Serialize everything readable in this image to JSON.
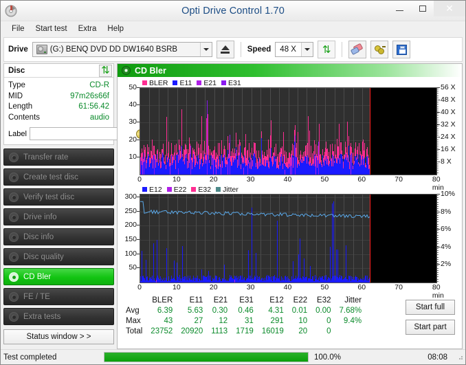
{
  "window": {
    "title": "Opti Drive Control 1.70",
    "icon": "disc-app-icon",
    "minimize": "–",
    "maximize": "□",
    "close": "✕"
  },
  "menubar": {
    "items": [
      {
        "label": "File"
      },
      {
        "label": "Start test"
      },
      {
        "label": "Extra"
      },
      {
        "label": "Help"
      }
    ]
  },
  "toolbar": {
    "drive_label": "Drive",
    "drive_letter": "(G:)",
    "drive_name": "BENQ DVD DD DW1640 BSRB",
    "drive_value": "(G:)   BENQ DVD DD DW1640 BSRB",
    "eject_icon": "eject-icon",
    "speed_label": "Speed",
    "speed_value": "48 X",
    "refresh_icon": "refresh-icon",
    "eraser_icon": "eraser-icon",
    "plug_icon": "plug-icon",
    "save_icon": "save-icon"
  },
  "disc": {
    "header": "Disc",
    "refresh_icon": "refresh-icon",
    "rows": [
      {
        "key": "Type",
        "value": "CD-R"
      },
      {
        "key": "MID",
        "value": "97m26s66f"
      },
      {
        "key": "Length",
        "value": "61:56.42"
      },
      {
        "key": "Contents",
        "value": "audio"
      }
    ],
    "label_key": "Label",
    "label_value": "",
    "label_placeholder": "",
    "disc_button_icon": "cd-icon"
  },
  "sidebar": {
    "items": [
      {
        "label": "Transfer rate",
        "icon": "disc-icon",
        "active": false
      },
      {
        "label": "Create test disc",
        "icon": "disc-write-icon",
        "active": false
      },
      {
        "label": "Verify test disc",
        "icon": "disc-check-icon",
        "active": false
      },
      {
        "label": "Drive info",
        "icon": "drive-info-icon",
        "active": false
      },
      {
        "label": "Disc info",
        "icon": "disc-info-icon",
        "active": false
      },
      {
        "label": "Disc quality",
        "icon": "disc-quality-icon",
        "active": false
      },
      {
        "label": "CD Bler",
        "icon": "cd-bler-icon",
        "active": true
      },
      {
        "label": "FE / TE",
        "icon": "fe-te-icon",
        "active": false
      },
      {
        "label": "Extra tests",
        "icon": "extra-tests-icon",
        "active": false
      }
    ],
    "status_window": "Status window > >"
  },
  "panel": {
    "title": "CD Bler",
    "icon": "cd-bler-icon",
    "start_full": "Start full",
    "start_part": "Start part"
  },
  "statusbar": {
    "text": "Test completed",
    "percent": "100.0%",
    "progress": 100,
    "time": "08:08",
    "accent": "#0aa00a"
  },
  "chart_data": [
    {
      "type": "bar",
      "name": "cd-bler-error-chart",
      "title": "",
      "xlabel": "min",
      "ylabel": "",
      "xlim": [
        0,
        80
      ],
      "ylim": [
        0,
        50
      ],
      "yticks": [
        10,
        20,
        30,
        40,
        50
      ],
      "xticks": [
        0,
        10,
        20,
        30,
        40,
        50,
        60,
        70,
        80
      ],
      "xtick_labels": [
        "0",
        "10",
        "20",
        "30",
        "40",
        "50",
        "60",
        "70",
        "80 min"
      ],
      "right_axis": {
        "label": "X",
        "ticks": [
          8,
          16,
          24,
          32,
          40,
          48,
          56
        ],
        "tick_labels": [
          "8 X",
          "16 X",
          "24 X",
          "32 X",
          "40 X",
          "48 X",
          "56 X"
        ],
        "lim": [
          0,
          56
        ]
      },
      "grid": true,
      "legend": [
        {
          "name": "BLER",
          "color": "#ff2e92"
        },
        {
          "name": "E11",
          "color": "#1a1aff"
        },
        {
          "name": "E21",
          "color": "#b020e8"
        },
        {
          "name": "E31",
          "color": "#8a1af0"
        }
      ],
      "data_end_min": 62,
      "cursor_min": 62,
      "series": [
        {
          "name": "BLER",
          "color": "#ff2e92",
          "description": "Pink BLER spikes, dense from 0 to 62 min, typical 8-25, peaks to 43",
          "avg": 6.39,
          "max": 43,
          "total": 23752
        },
        {
          "name": "E11",
          "color": "#1a1aff",
          "description": "Blue E11 band filling 0-62 min, typical 4-12, peaks to 27",
          "avg": 5.63,
          "max": 27,
          "total": 20920
        },
        {
          "name": "E21",
          "color": "#b020e8",
          "description": "Sparse purple E21 spikes to 12",
          "avg": 0.3,
          "max": 12,
          "total": 1113
        },
        {
          "name": "E31",
          "color": "#8a1af0",
          "description": "Sparse violet E31 spikes to 31, one spike near 18 min reaching 43",
          "avg": 0.46,
          "max": 31,
          "total": 1719
        }
      ]
    },
    {
      "type": "line",
      "name": "cd-bler-jitter-chart",
      "title": "",
      "xlabel": "min",
      "ylabel": "",
      "xlim": [
        0,
        80
      ],
      "ylim": [
        0,
        310
      ],
      "yticks": [
        50,
        100,
        150,
        200,
        250,
        300
      ],
      "xticks": [
        0,
        10,
        20,
        30,
        40,
        50,
        60,
        70,
        80
      ],
      "xtick_labels": [
        "0",
        "10",
        "20",
        "30",
        "40",
        "50",
        "60",
        "70",
        "80 min"
      ],
      "right_axis": {
        "label": "%",
        "ticks": [
          2,
          4,
          6,
          8,
          10
        ],
        "tick_labels": [
          "2%",
          "4%",
          "6%",
          "8%",
          "10%"
        ],
        "lim": [
          0,
          10
        ]
      },
      "grid": true,
      "legend": [
        {
          "name": "E12",
          "color": "#1a1aff"
        },
        {
          "name": "E22",
          "color": "#b020e8"
        },
        {
          "name": "E32",
          "color": "#ff2e92"
        },
        {
          "name": "Jitter",
          "color": "#4e8a8a"
        }
      ],
      "data_end_min": 62,
      "cursor_min": 62,
      "series": [
        {
          "name": "E12",
          "color": "#1a1aff",
          "description": "Blue E12 spikes from baseline, typical 10-60, many spikes 150-290",
          "avg": 4.31,
          "max": 291,
          "total": 16019
        },
        {
          "name": "E22",
          "color": "#b020e8",
          "description": "Nearly absent, a couple of tiny spikes",
          "avg": 0.01,
          "max": 10,
          "total": 20
        },
        {
          "name": "E32",
          "color": "#ff2e92",
          "description": "No visible data",
          "avg": 0.0,
          "max": 0,
          "total": 0
        },
        {
          "name": "Jitter",
          "color": "#5aa8e8",
          "description": "Light-blue jitter trace around 7.6-8%, declining slightly toward 62 min",
          "avg": "7.68%",
          "max": "9.4%",
          "total": ""
        }
      ]
    }
  ],
  "stats": {
    "columns": [
      "BLER",
      "E11",
      "E21",
      "E31",
      "E12",
      "E22",
      "E32",
      "Jitter"
    ],
    "rows": [
      {
        "label": "Avg",
        "values": [
          "6.39",
          "5.63",
          "0.30",
          "0.46",
          "4.31",
          "0.01",
          "0.00",
          "7.68%"
        ]
      },
      {
        "label": "Max",
        "values": [
          "43",
          "27",
          "12",
          "31",
          "291",
          "10",
          "0",
          "9.4%"
        ]
      },
      {
        "label": "Total",
        "values": [
          "23752",
          "20920",
          "1113",
          "1719",
          "16019",
          "20",
          "0",
          ""
        ]
      }
    ]
  }
}
